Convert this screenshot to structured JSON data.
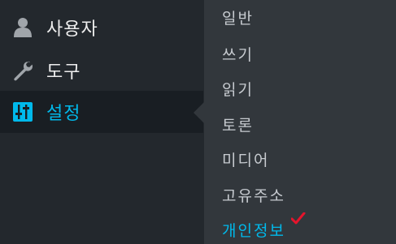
{
  "sidebar": {
    "items": [
      {
        "label": "사용자",
        "icon": "user-icon"
      },
      {
        "label": "도구",
        "icon": "wrench-icon"
      },
      {
        "label": "설정",
        "icon": "settings-sliders-icon"
      }
    ]
  },
  "submenu": {
    "items": [
      {
        "label": "일반"
      },
      {
        "label": "쓰기"
      },
      {
        "label": "읽기"
      },
      {
        "label": "토론"
      },
      {
        "label": "미디어"
      },
      {
        "label": "고유주소"
      },
      {
        "label": "개인정보"
      }
    ]
  },
  "colors": {
    "sidebar_bg": "#23282d",
    "active_item_bg": "#191e23",
    "submenu_bg": "#32373c",
    "accent": "#00b9eb",
    "checkmark": "#e5142c"
  }
}
